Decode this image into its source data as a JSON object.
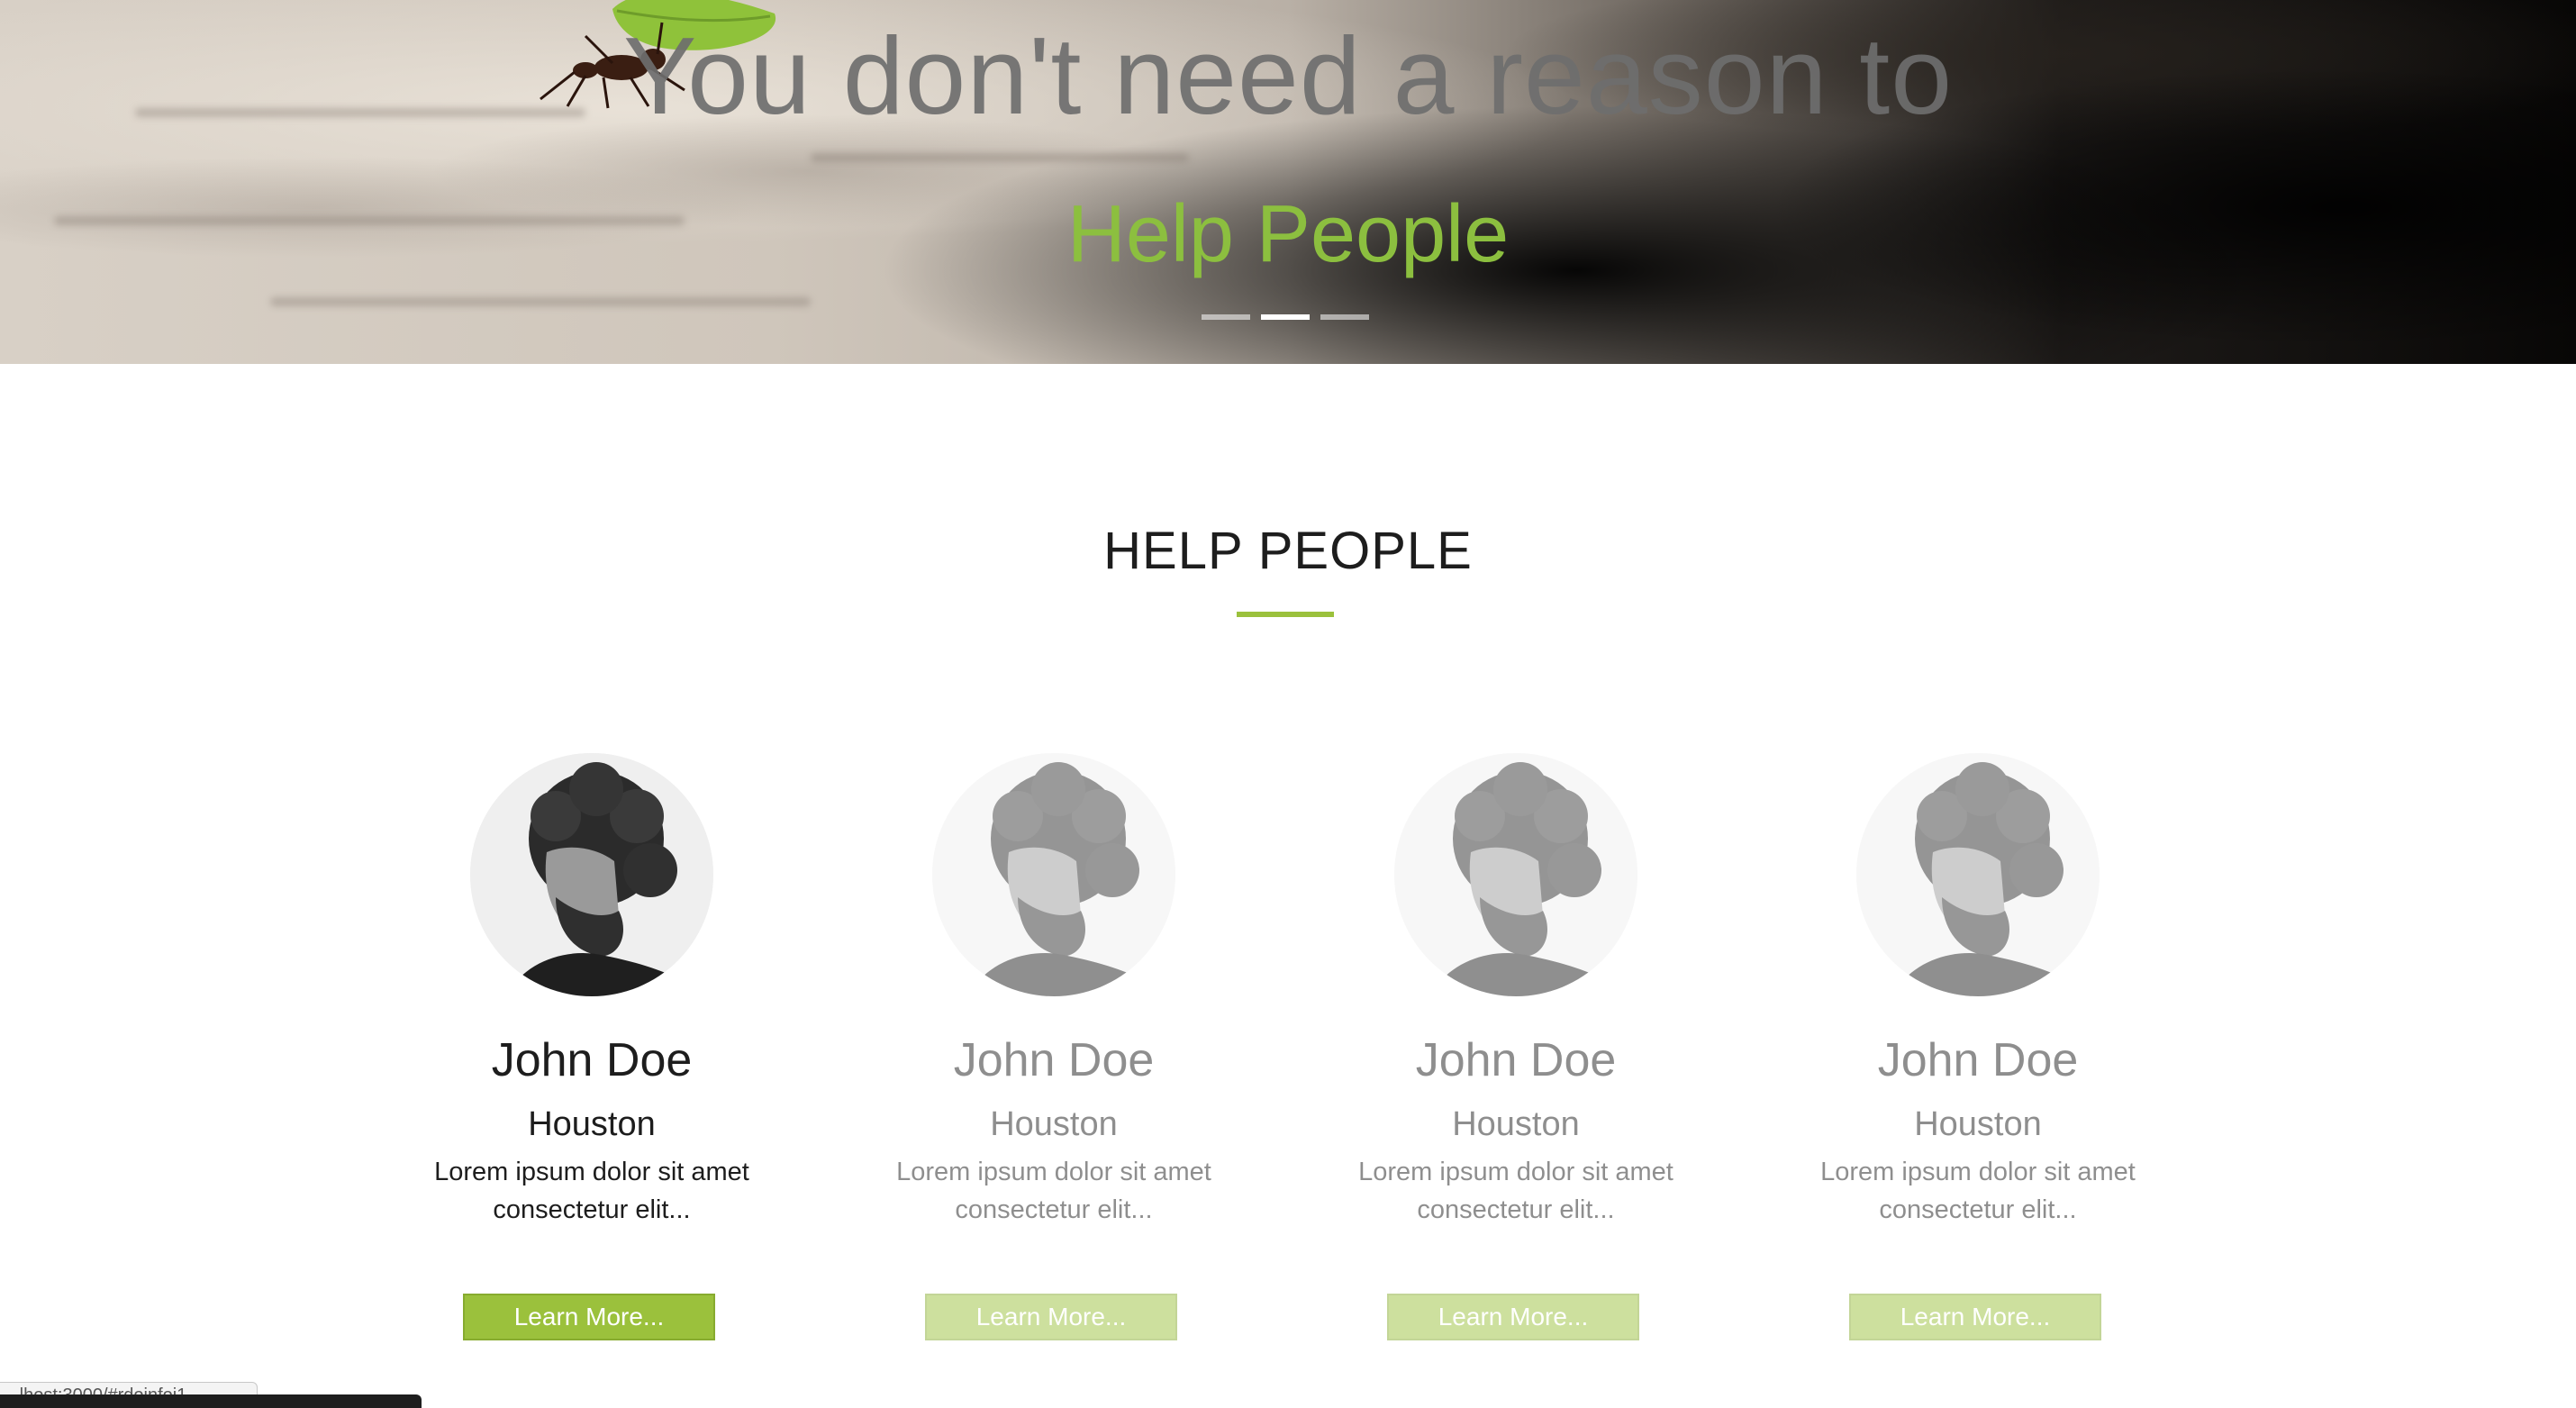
{
  "hero": {
    "title": "You don't need a reason to",
    "subtitle": "Help People",
    "indicators": [
      {
        "active": false
      },
      {
        "active": true
      },
      {
        "active": false
      }
    ],
    "accent_color": "#8cbf3f"
  },
  "section": {
    "title": "HELP PEOPLE",
    "divider_color": "#9bc13c"
  },
  "cards": [
    {
      "name": "John Doe",
      "city": "Houston",
      "description": "Lorem ipsum dolor sit amet consectetur elit...",
      "button_label": "Learn More...",
      "highlighted": true
    },
    {
      "name": "John Doe",
      "city": "Houston",
      "description": "Lorem ipsum dolor sit amet consectetur elit...",
      "button_label": "Learn More...",
      "highlighted": false
    },
    {
      "name": "John Doe",
      "city": "Houston",
      "description": "Lorem ipsum dolor sit amet consectetur elit...",
      "button_label": "Learn More...",
      "highlighted": false
    },
    {
      "name": "John Doe",
      "city": "Houston",
      "description": "Lorem ipsum dolor sit amet consectetur elit...",
      "button_label": "Learn More...",
      "highlighted": false
    }
  ],
  "status": {
    "url": "...lhost:3000/#rdoinfoi1"
  }
}
